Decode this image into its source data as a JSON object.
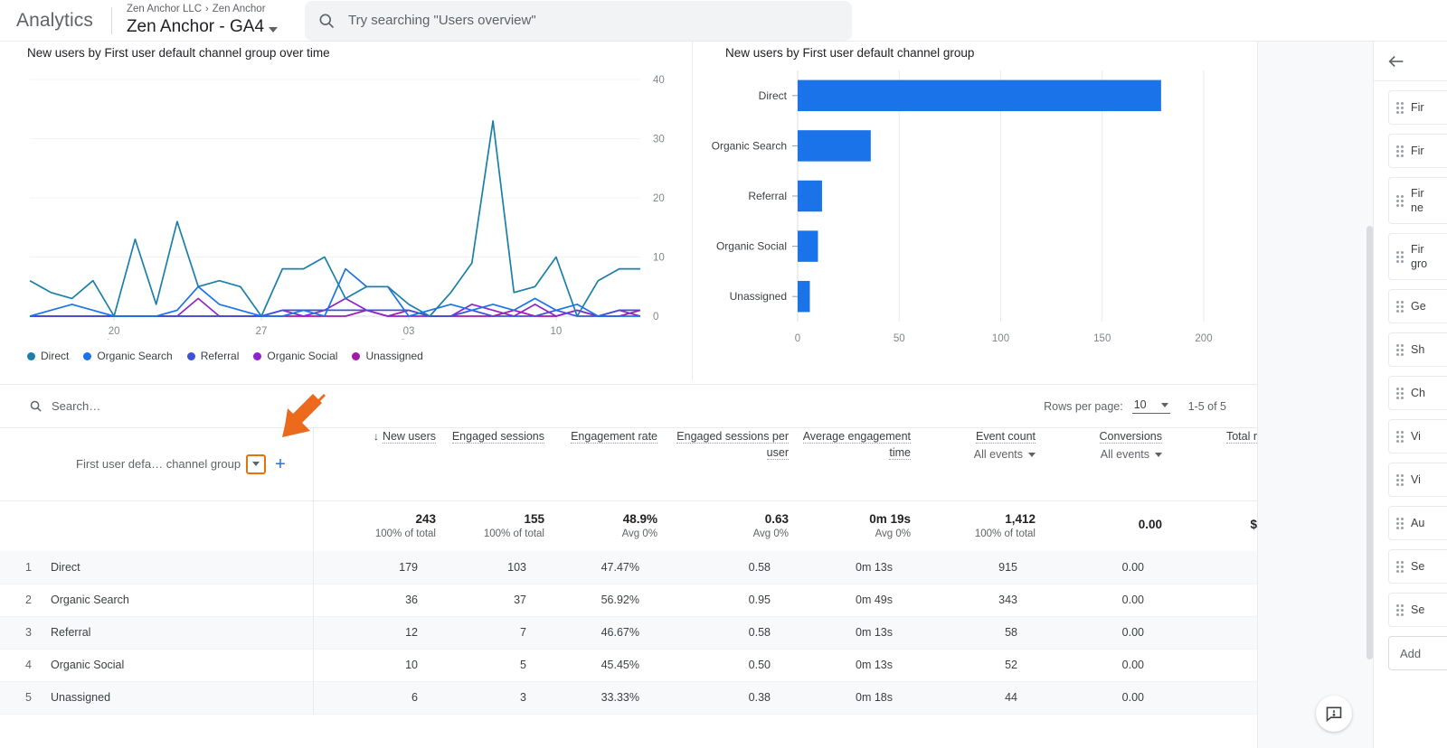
{
  "header": {
    "wordmark": "Analytics",
    "breadcrumb_account": "Zen Anchor LLC",
    "breadcrumb_sep": "›",
    "breadcrumb_property": "Zen Anchor",
    "property_name": "Zen Anchor - GA4",
    "search_placeholder": "Try searching \"Users overview\"",
    "search_icon": "search-icon",
    "property_caret_icon": "chevron-down-icon"
  },
  "line_card": {
    "title": "New users by First user default channel group over time"
  },
  "bar_card": {
    "title": "New users by First user default channel group"
  },
  "table": {
    "search_placeholder": "Search…",
    "search_icon": "search-icon",
    "rows_per_page_label": "Rows per page:",
    "rows_per_page_value": "10",
    "rows_per_page_caret_icon": "chevron-down-icon",
    "range": "1-5 of 5",
    "dimension_header": "First user defa… channel group",
    "dimension_dropdown_icon": "chevron-down-icon",
    "add_dimension_icon": "plus-icon",
    "sort_indicator": "↓",
    "columns": [
      {
        "label": "New users",
        "sub": "",
        "sorted": true
      },
      {
        "label": "Engaged sessions",
        "sub": ""
      },
      {
        "label": "Engagement rate",
        "sub": ""
      },
      {
        "label": "Engaged sessions per user",
        "sub": ""
      },
      {
        "label": "Average engagement time",
        "sub": ""
      },
      {
        "label": "Event count",
        "sub": "All events"
      },
      {
        "label": "Conversions",
        "sub": "All events"
      },
      {
        "label": "Total r",
        "sub": ""
      }
    ],
    "totals": [
      {
        "value": "243",
        "note": "100% of total"
      },
      {
        "value": "155",
        "note": "100% of total"
      },
      {
        "value": "48.9%",
        "note": "Avg 0%"
      },
      {
        "value": "0.63",
        "note": "Avg 0%"
      },
      {
        "value": "0m 19s",
        "note": "Avg 0%"
      },
      {
        "value": "1,412",
        "note": "100% of total"
      },
      {
        "value": "0.00",
        "note": ""
      },
      {
        "value": "$",
        "note": ""
      }
    ],
    "rows": [
      {
        "index": "1",
        "dimension": "Direct",
        "values": [
          "179",
          "103",
          "47.47%",
          "0.58",
          "0m 13s",
          "915",
          "0.00",
          ""
        ]
      },
      {
        "index": "2",
        "dimension": "Organic Search",
        "values": [
          "36",
          "37",
          "56.92%",
          "0.95",
          "0m 49s",
          "343",
          "0.00",
          ""
        ]
      },
      {
        "index": "3",
        "dimension": "Referral",
        "values": [
          "12",
          "7",
          "46.67%",
          "0.58",
          "0m 13s",
          "58",
          "0.00",
          ""
        ]
      },
      {
        "index": "4",
        "dimension": "Organic Social",
        "values": [
          "10",
          "5",
          "45.45%",
          "0.50",
          "0m 13s",
          "52",
          "0.00",
          ""
        ]
      },
      {
        "index": "5",
        "dimension": "Unassigned",
        "values": [
          "6",
          "3",
          "33.33%",
          "0.38",
          "0m 18s",
          "44",
          "0.00",
          ""
        ]
      }
    ]
  },
  "right_panel": {
    "back_icon": "arrow-left-icon",
    "items": [
      {
        "label": "Fir",
        "tall": false
      },
      {
        "label": "Fir",
        "tall": false
      },
      {
        "label": "Fir\nne",
        "tall": true
      },
      {
        "label": "Fir\ngro",
        "tall": true
      },
      {
        "label": "Ge",
        "tall": false
      },
      {
        "label": "Sh",
        "tall": false
      },
      {
        "label": "Ch",
        "tall": false
      },
      {
        "label": "Vi",
        "tall": false
      },
      {
        "label": "Vi",
        "tall": false
      },
      {
        "label": "Au",
        "tall": false
      },
      {
        "label": "Se",
        "tall": false
      },
      {
        "label": "Se",
        "tall": false
      }
    ],
    "add_label": "Add"
  },
  "feedback": {
    "icon": "feedback-icon"
  },
  "annotation": {
    "arrow_color": "#ec6a1e",
    "highlight_color": "#e8710a"
  },
  "colors": {
    "direct": "#1b7fa8",
    "organic_search": "#1a73e8",
    "referral": "#3f51d6",
    "organic_social": "#8e24c9",
    "unassigned": "#a01ba8",
    "bar_blue": "#1a73e8",
    "accent_blue": "#1a73e8"
  },
  "chart_data": [
    {
      "type": "line",
      "title": "New users by First user default channel group over time",
      "xlabel": "",
      "ylabel": "",
      "ylim": [
        0,
        40
      ],
      "yticks": [
        0,
        10,
        20,
        30,
        40
      ],
      "grid": true,
      "legend_position": "bottom-left",
      "x_tick_labels": [
        {
          "pos": 4,
          "line1": "20",
          "line2": "Aug"
        },
        {
          "pos": 11,
          "line1": "27",
          "line2": ""
        },
        {
          "pos": 18,
          "line1": "03",
          "line2": "Sep"
        },
        {
          "pos": 25,
          "line1": "10",
          "line2": ""
        }
      ],
      "x": [
        0,
        1,
        2,
        3,
        4,
        5,
        6,
        7,
        8,
        9,
        10,
        11,
        12,
        13,
        14,
        15,
        16,
        17,
        18,
        19,
        20,
        21,
        22,
        23,
        24,
        25,
        26,
        27,
        28,
        29
      ],
      "series": [
        {
          "name": "Direct",
          "color": "#1b7fa8",
          "values": [
            6,
            4,
            3,
            6,
            0,
            13,
            2,
            16,
            5,
            6,
            5,
            0,
            8,
            8,
            10,
            3,
            5,
            5,
            2,
            0,
            4,
            9,
            33,
            4,
            5,
            10,
            0,
            6,
            8,
            8
          ]
        },
        {
          "name": "Organic Search",
          "color": "#1a73e8",
          "values": [
            0,
            1,
            2,
            1,
            0,
            0,
            0,
            1,
            5,
            2,
            1,
            0,
            0,
            1,
            0,
            8,
            5,
            5,
            0,
            1,
            2,
            1,
            2,
            1,
            3,
            1,
            2,
            0,
            0,
            0
          ]
        },
        {
          "name": "Referral",
          "color": "#3f51d6",
          "values": [
            0,
            0,
            0,
            0,
            0,
            0,
            0,
            0,
            0,
            0,
            0,
            0,
            1,
            1,
            1,
            1,
            1,
            1,
            1,
            0,
            0,
            1,
            0,
            0,
            0,
            1,
            0,
            0,
            1,
            1
          ]
        },
        {
          "name": "Organic Social",
          "color": "#8e24c9",
          "values": [
            0,
            0,
            0,
            0,
            0,
            0,
            0,
            0,
            3,
            0,
            0,
            0,
            1,
            0,
            1,
            3,
            1,
            0,
            0,
            0,
            0,
            2,
            1,
            0,
            2,
            0,
            1,
            0,
            1,
            0
          ]
        },
        {
          "name": "Unassigned",
          "color": "#a01ba8",
          "values": [
            0,
            0,
            0,
            0,
            0,
            0,
            0,
            0,
            0,
            0,
            0,
            0,
            0,
            0,
            0,
            0,
            1,
            0,
            1,
            0,
            0,
            0,
            0,
            1,
            0,
            0,
            1,
            0,
            0,
            1
          ]
        }
      ]
    },
    {
      "type": "bar",
      "orientation": "horizontal",
      "title": "New users by First user default channel group",
      "categories": [
        "Direct",
        "Organic Search",
        "Referral",
        "Organic Social",
        "Unassigned"
      ],
      "values": [
        179,
        36,
        12,
        10,
        6
      ],
      "xlim": [
        0,
        200
      ],
      "xticks": [
        0,
        50,
        100,
        150,
        200
      ],
      "xlabel": "",
      "ylabel": "",
      "grid": true,
      "bar_color": "#1a73e8"
    }
  ]
}
